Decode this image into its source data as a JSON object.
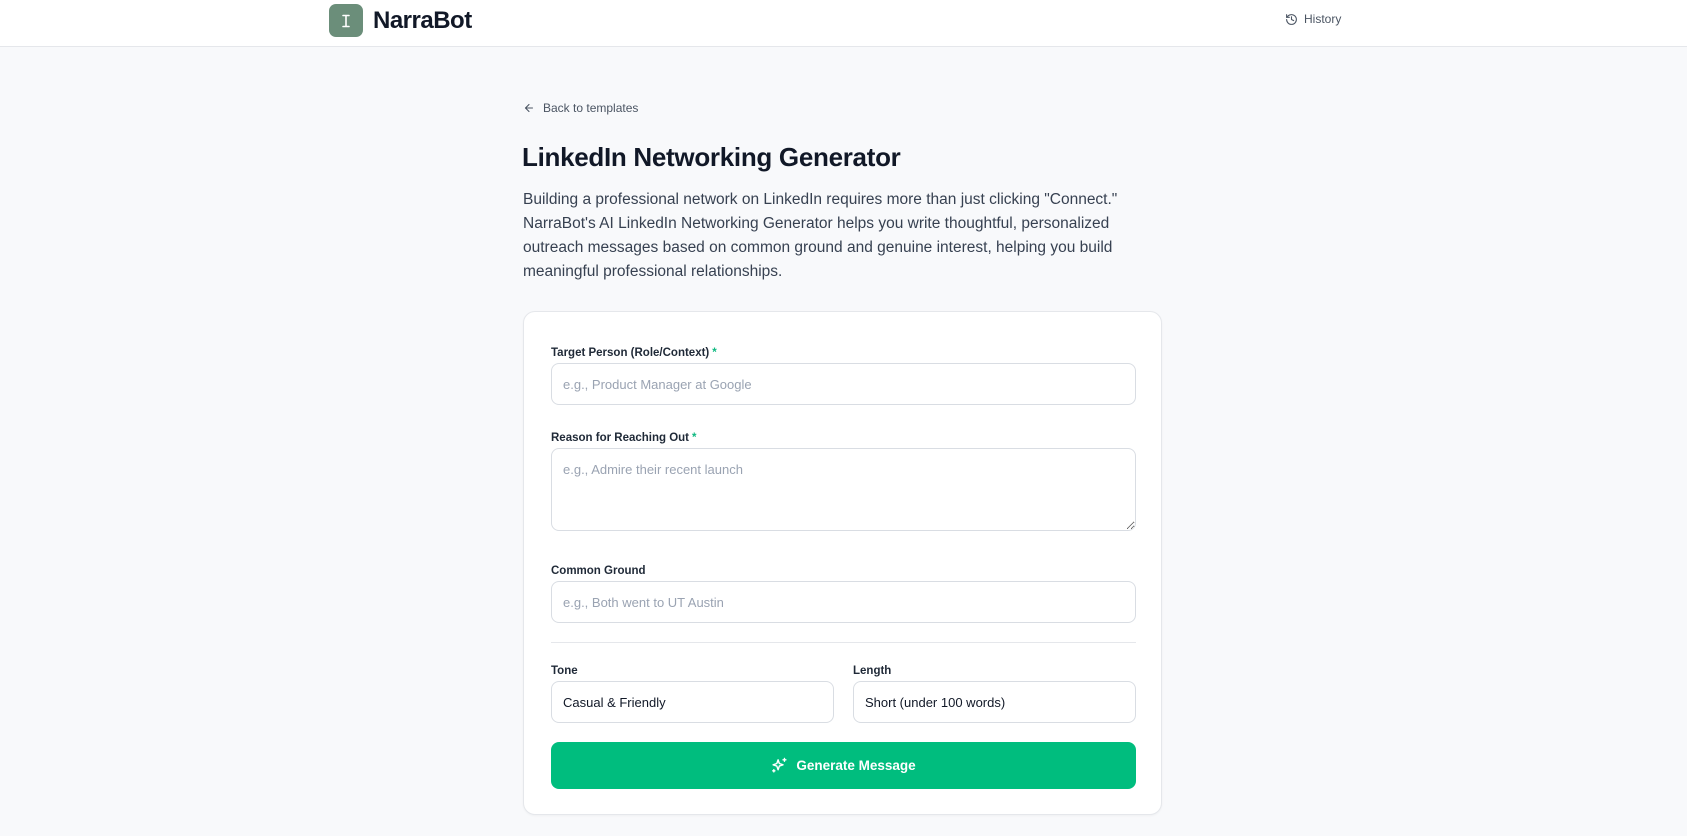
{
  "header": {
    "brand_mark": "I",
    "brand_name": "NarraBot",
    "history_label": "History"
  },
  "nav": {
    "back_label": "Back to templates"
  },
  "page": {
    "title": "LinkedIn Networking Generator",
    "description": "Building a professional network on LinkedIn requires more than just clicking \"Connect.\" NarraBot's AI LinkedIn Networking Generator helps you write thoughtful, personalized outreach messages based on common ground and genuine interest, helping you build meaningful professional relationships."
  },
  "form": {
    "target": {
      "label": "Target Person (Role/Context)",
      "required_mark": "*",
      "value": "",
      "placeholder": "e.g., Product Manager at Google"
    },
    "reason": {
      "label": "Reason for Reaching Out",
      "required_mark": "*",
      "value": "",
      "placeholder": "e.g., Admire their recent launch"
    },
    "common_ground": {
      "label": "Common Ground",
      "value": "",
      "placeholder": "e.g., Both went to UT Austin"
    },
    "tone": {
      "label": "Tone",
      "selected": "Casual & Friendly"
    },
    "length": {
      "label": "Length",
      "selected": "Short (under 100 words)"
    },
    "generate_label": "Generate Message"
  },
  "colors": {
    "accent": "#00bd7e",
    "brand_logo_bg": "#6b8e7a",
    "required": "#10b981"
  },
  "icons": {
    "brand": "text-cursor-icon",
    "history": "history-icon",
    "back": "arrow-left-icon",
    "generate": "sparkles-icon"
  }
}
